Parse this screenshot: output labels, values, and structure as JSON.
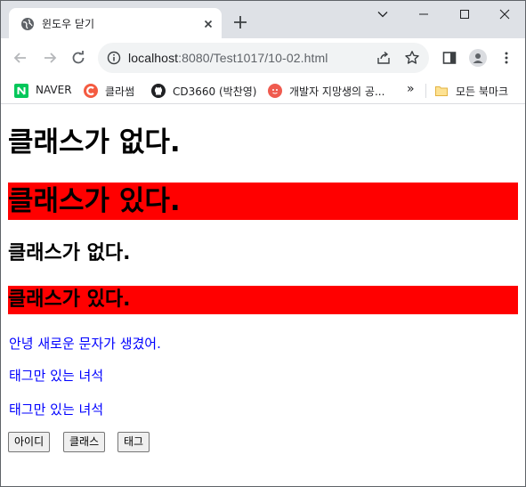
{
  "browser": {
    "tab": {
      "title": "윈도우 닫기"
    },
    "address": {
      "host": "localhost",
      "rest": ":8080/Test1017/10-02.html"
    },
    "bookmarks": [
      {
        "label": "NAVER",
        "icon": "naver-icon"
      },
      {
        "label": "클라썸",
        "icon": "classum-icon"
      },
      {
        "label": "CD3660 (박찬영)",
        "icon": "github-icon"
      },
      {
        "label": "개발자 지망생의 공...",
        "icon": "blog-icon"
      }
    ],
    "overflow_label": "»",
    "all_bookmarks_label": "모든 북마크"
  },
  "page": {
    "h1_no_class": "클래스가 없다.",
    "h1_with_class": "클래스가 있다.",
    "h2_no_class": "클래스가 없다.",
    "h2_with_class": "클래스가 있다.",
    "para_new": "안녕 새로운 문자가 생겼어.",
    "para_tag_1": "태그만 있는 녀석",
    "para_tag_2": "태그만 있는 녀석",
    "buttons": {
      "id": "아이디",
      "class": "클래스",
      "tag": "태그"
    }
  },
  "colors": {
    "class_highlight": "#ff0000",
    "paragraph_text": "#0000ff",
    "tabstrip_bg": "#dee1e6"
  }
}
